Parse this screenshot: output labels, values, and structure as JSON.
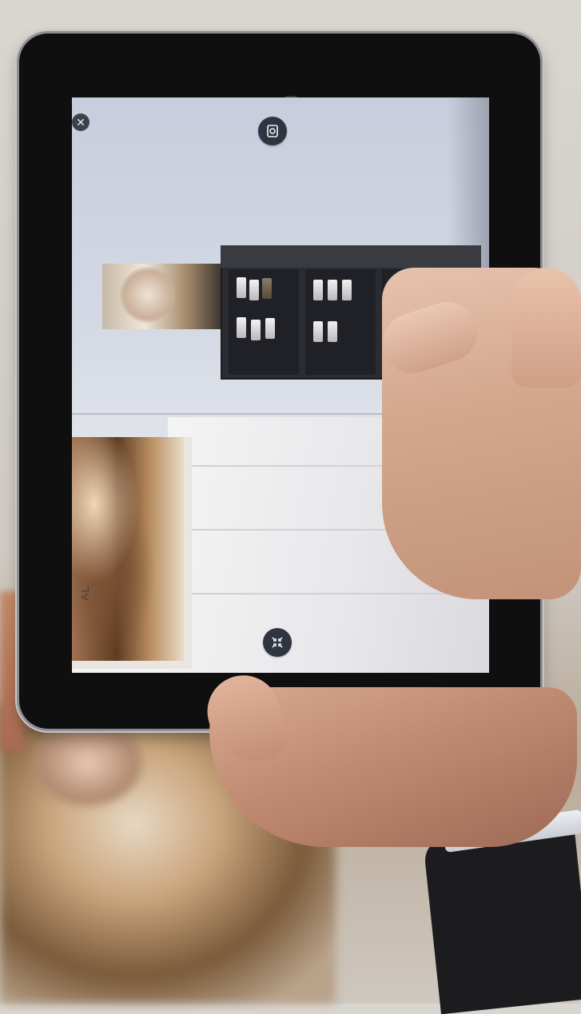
{
  "scene": {
    "description_labels": {
      "device": "tablet",
      "app_mode": "augmented-reality-view"
    }
  },
  "ar_ui": {
    "close_icon": "close-icon",
    "camera_icon": "camera-icon",
    "collapse_icon": "collapse-arrows-icon"
  },
  "poster": {
    "text": "AL"
  },
  "colors": {
    "button_bg": "#2e3440",
    "shelf": "#2b2c31",
    "bezel": "#0f0f10"
  }
}
